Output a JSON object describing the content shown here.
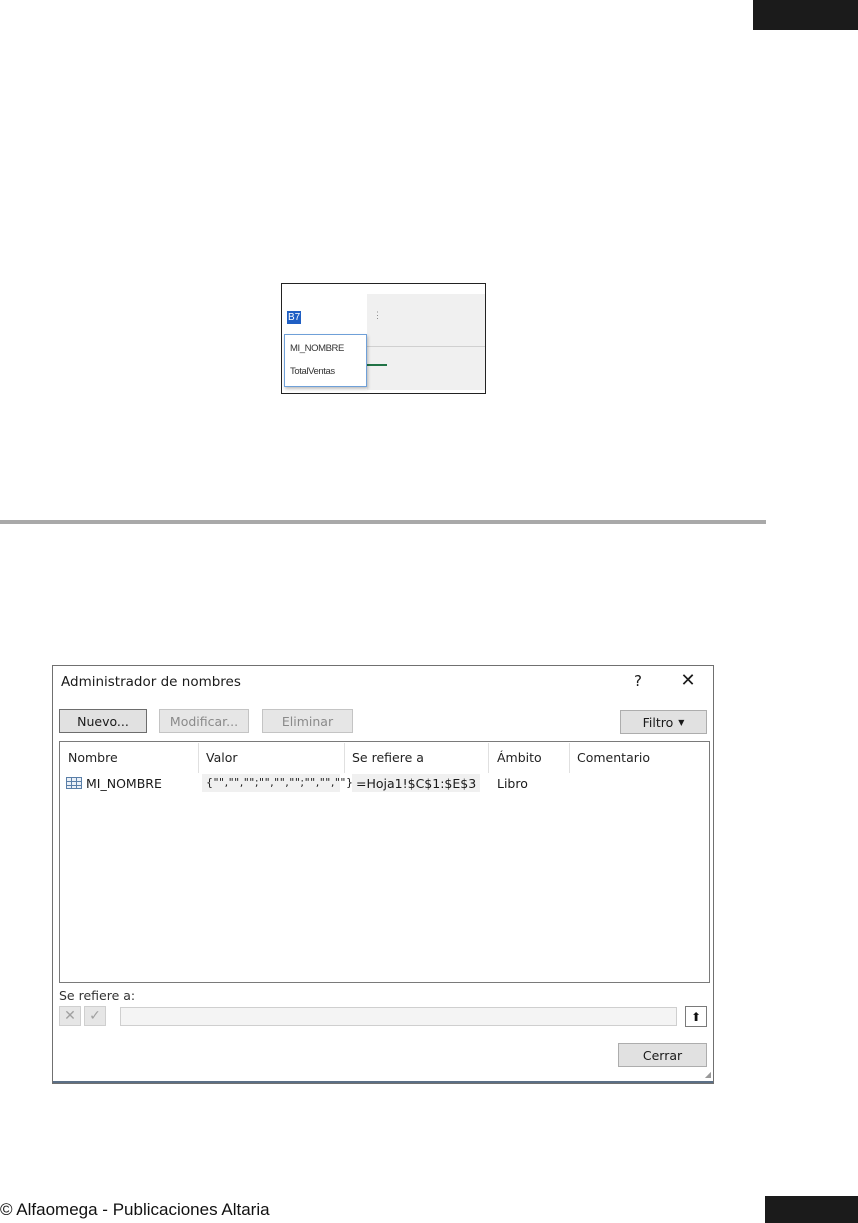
{
  "namebox_capture": {
    "cell_reference": "B7",
    "dropdown_items": [
      "MI_NOMBRE",
      "TotalVentas"
    ]
  },
  "dialog": {
    "title": "Administrador de nombres",
    "help_label": "?",
    "close_label": "✕",
    "buttons": {
      "nuevo": "Nuevo...",
      "modificar": "Modificar...",
      "eliminar": "Eliminar",
      "filtro": "Filtro",
      "cerrar": "Cerrar"
    },
    "columns": [
      "Nombre",
      "Valor",
      "Se refiere a",
      "Ámbito",
      "Comentario"
    ],
    "rows": [
      {
        "nombre": "MI_NOMBRE",
        "valor": "{\"\",\"\",\"\";\"\",\"\",\"\";\"\",\"\",\"\"}",
        "se_refiere_a": "=Hoja1!$C$1:$E$3",
        "ambito": "Libro",
        "comentario": ""
      }
    ],
    "refers_to_label": "Se refiere a:",
    "refers_to_value": ""
  },
  "footer": {
    "copyright": "© Alfaomega - Publicaciones Altaria"
  }
}
